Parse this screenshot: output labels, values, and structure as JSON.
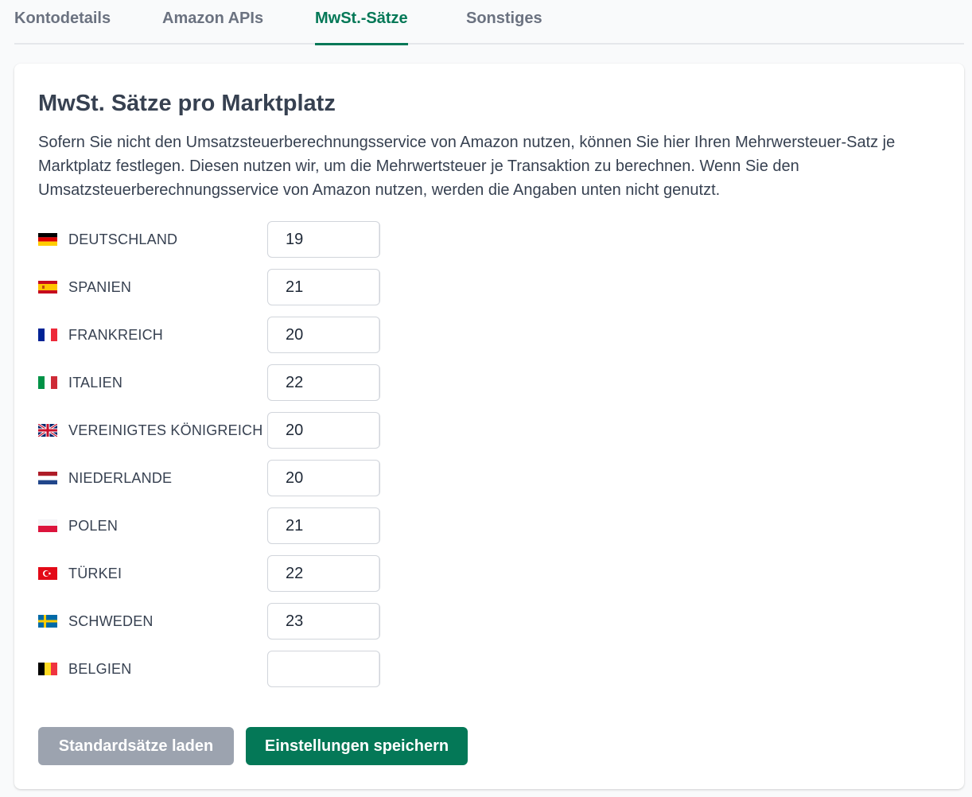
{
  "tabs": [
    "Kontodetails",
    "Amazon APIs",
    "MwSt.-Sätze",
    "Sonstiges"
  ],
  "active_tab": "MwSt.-Sätze",
  "accent_color": "#047857",
  "card": {
    "title": "MwSt. Sätze pro Marktplatz",
    "description": "Sofern Sie nicht den Umsatzsteuerberechnungsservice von Amazon nutzen, können Sie hier Ihren Mehrwersteuer-Satz je Marktplatz festlegen. Diesen nutzen wir, um die Mehrwertsteuer je Transaktion zu berechnen. Wenn Sie den Umsatzsteuerberechnungsservice von Amazon nutzen, werden die Angaben unten nicht genutzt."
  },
  "marketplaces": [
    {
      "country": "DEUTSCHLAND",
      "flag": "germany-flag-icon",
      "vat": "19"
    },
    {
      "country": "SPANIEN",
      "flag": "spain-flag-icon",
      "vat": "21"
    },
    {
      "country": "FRANKREICH",
      "flag": "france-flag-icon",
      "vat": "20"
    },
    {
      "country": "ITALIEN",
      "flag": "italy-flag-icon",
      "vat": "22"
    },
    {
      "country": "VEREINIGTES KÖNIGREICH",
      "flag": "uk-flag-icon",
      "vat": "20"
    },
    {
      "country": "NIEDERLANDE",
      "flag": "netherlands-flag-icon",
      "vat": "20"
    },
    {
      "country": "POLEN",
      "flag": "poland-flag-icon",
      "vat": "21"
    },
    {
      "country": "TÜRKEI",
      "flag": "turkey-flag-icon",
      "vat": "22"
    },
    {
      "country": "SCHWEDEN",
      "flag": "sweden-flag-icon",
      "vat": "23"
    },
    {
      "country": "BELGIEN",
      "flag": "belgium-flag-icon",
      "vat": ""
    }
  ],
  "buttons": {
    "load_defaults": "Standardsätze laden",
    "save": "Einstellungen speichern"
  }
}
